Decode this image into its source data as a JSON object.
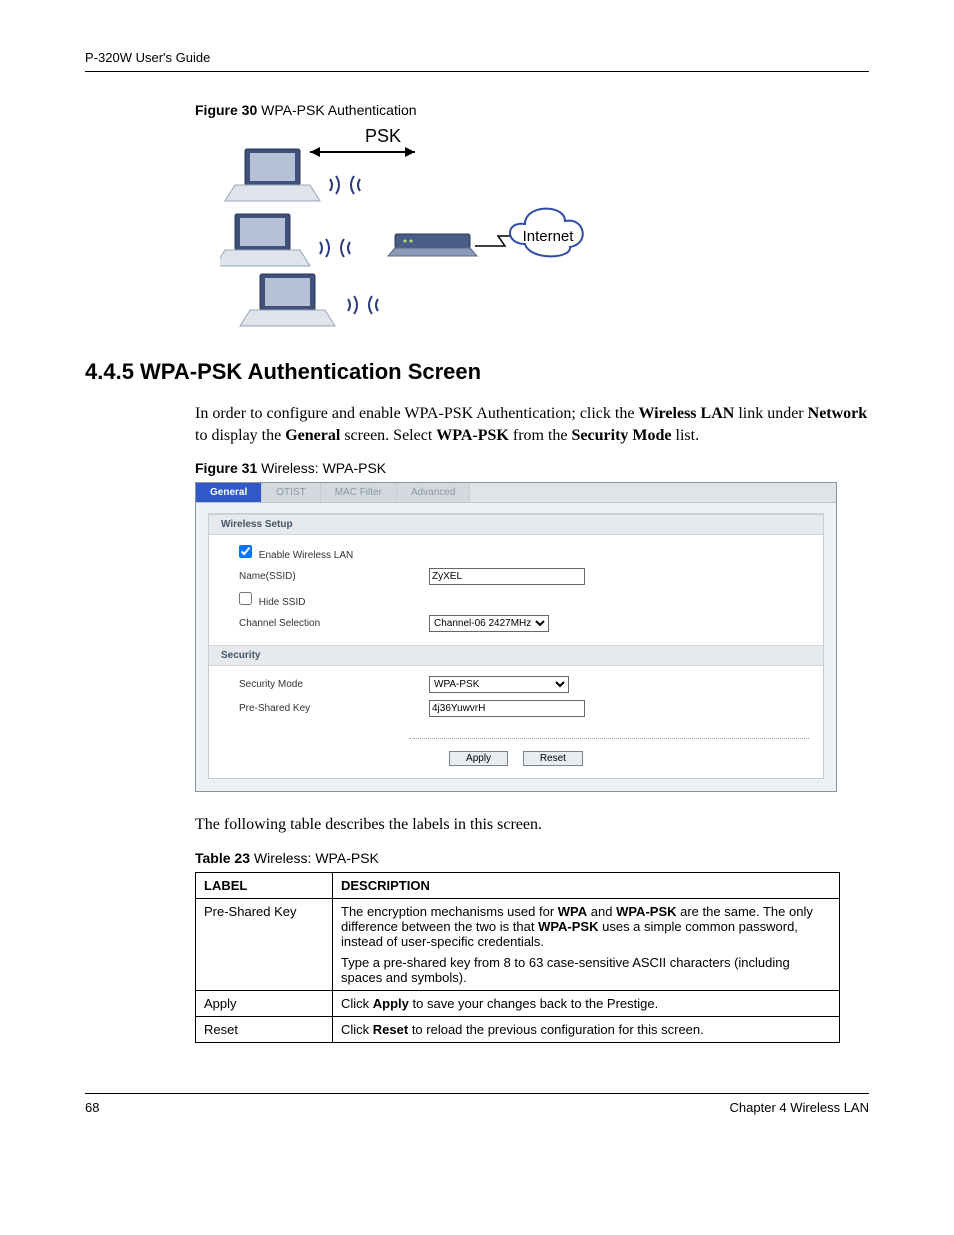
{
  "header": {
    "guide_title": "P-320W User's Guide"
  },
  "figure30": {
    "label_bold": "Figure 30",
    "label_rest": "   WPA-PSK Authentication",
    "psk_label": "PSK",
    "internet_label": "Internet"
  },
  "section": {
    "heading": "4.4.5  WPA-PSK Authentication Screen",
    "intro_pre": "In order to configure and enable WPA-PSK Authentication; click the ",
    "intro_b1": "Wireless LAN",
    "intro_mid1": " link under ",
    "intro_b2": "Network",
    "intro_mid2": " to display the ",
    "intro_b3": "General",
    "intro_mid3": " screen. Select ",
    "intro_b4": "WPA-PSK",
    "intro_mid4": " from the ",
    "intro_b5": "Security Mode",
    "intro_post": " list."
  },
  "figure31": {
    "label_bold": "Figure 31",
    "label_rest": "   Wireless: WPA-PSK"
  },
  "ui": {
    "tabs": {
      "general": "General",
      "otist": "OTIST",
      "mac": "MAC Filter",
      "adv": "Advanced"
    },
    "sect_wireless": "Wireless Setup",
    "enable_wlan": "Enable Wireless LAN",
    "name_ssid_lbl": "Name(SSID)",
    "name_ssid_val": "ZyXEL",
    "hide_ssid": "Hide SSID",
    "channel_lbl": "Channel Selection",
    "channel_val": "Channel-06 2427MHz",
    "sect_security": "Security",
    "sec_mode_lbl": "Security Mode",
    "sec_mode_val": "WPA-PSK",
    "psk_lbl": "Pre-Shared Key",
    "psk_val": "4j36YuwvrH",
    "apply_btn": "Apply",
    "reset_btn": "Reset"
  },
  "after_ui": "The following table describes the labels in this screen.",
  "table23": {
    "caption_bold": "Table 23",
    "caption_rest": "   Wireless: WPA-PSK",
    "head_label": "LABEL",
    "head_desc": "DESCRIPTION",
    "rows": [
      {
        "label": "Pre-Shared Key",
        "p1_pre": "The encryption mechanisms used for ",
        "p1_b1": "WPA",
        "p1_mid1": " and ",
        "p1_b2": "WPA-PSK",
        "p1_mid2": " are the same. The only difference between the two is that ",
        "p1_b3": "WPA-PSK",
        "p1_post": " uses a simple common password, instead of user-specific credentials.",
        "p2": "Type a pre-shared key from 8 to 63 case-sensitive ASCII characters (including spaces and symbols)."
      },
      {
        "label": "Apply",
        "p1_pre": "Click ",
        "p1_b1": "Apply",
        "p1_post": " to save your changes back to the Prestige."
      },
      {
        "label": "Reset",
        "p1_pre": "Click ",
        "p1_b1": "Reset",
        "p1_post": " to reload the previous configuration for this screen."
      }
    ]
  },
  "footer": {
    "page": "68",
    "chapter": "Chapter 4 Wireless LAN"
  }
}
